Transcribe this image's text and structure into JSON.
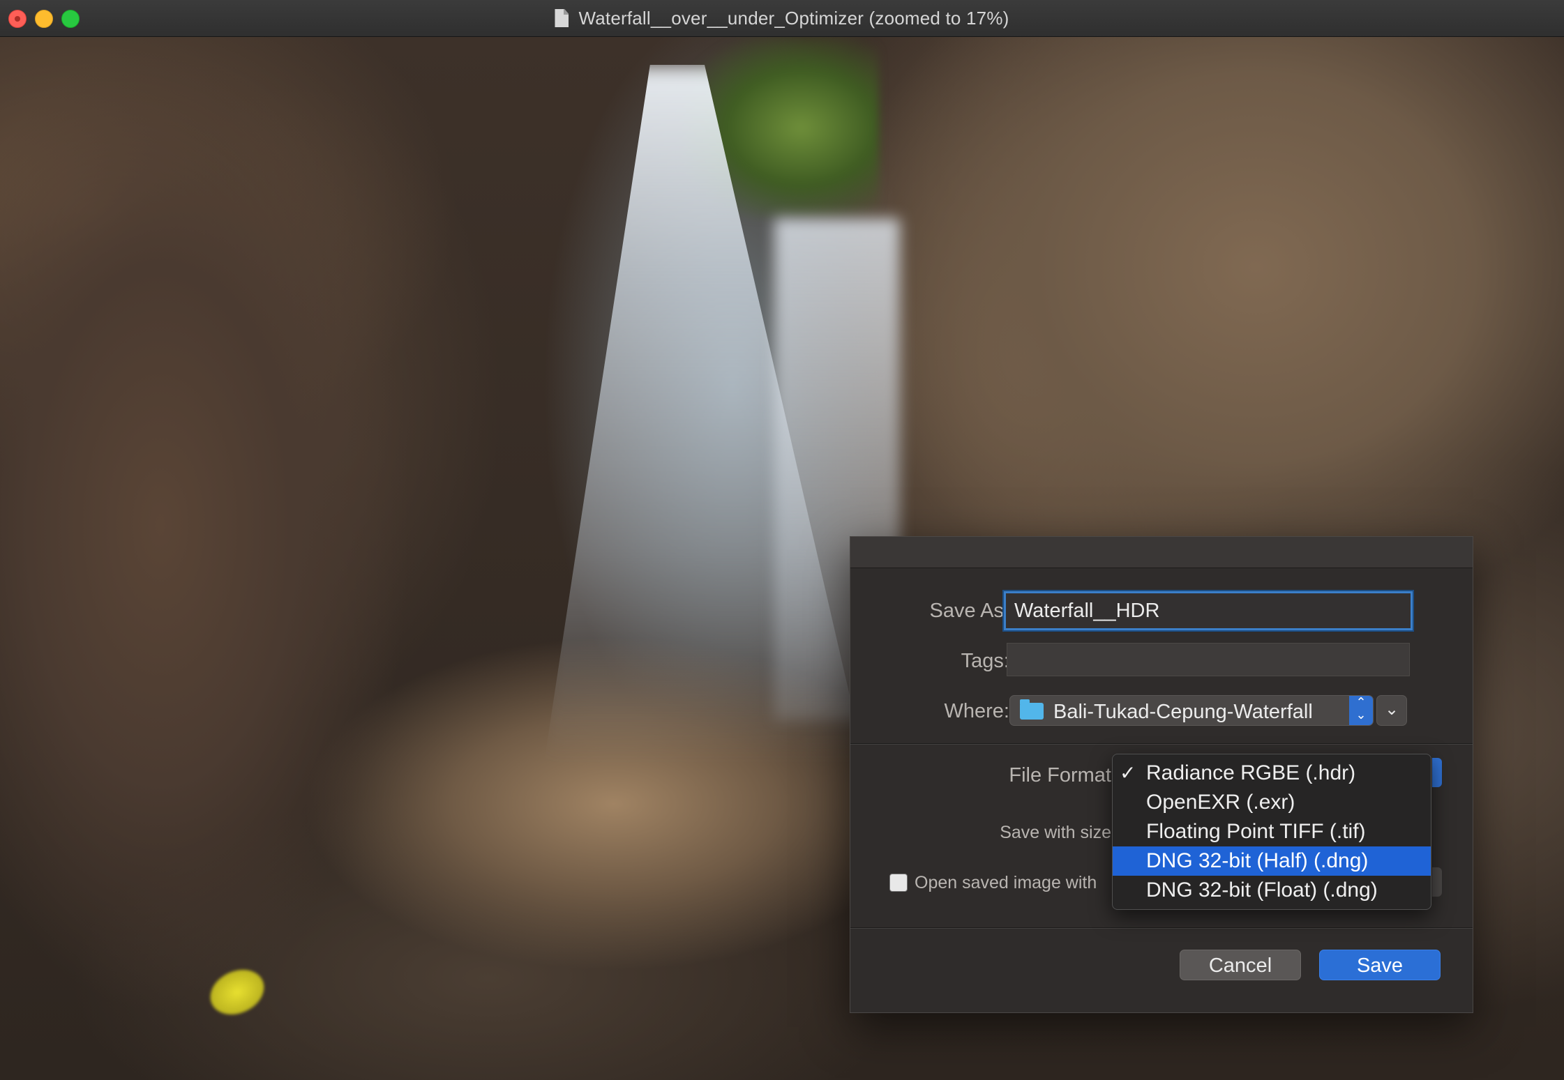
{
  "window": {
    "title": "Waterfall__over__under_Optimizer (zoomed to 17%)"
  },
  "dialog": {
    "save_as_label": "Save As:",
    "save_as_value": "Waterfall__HDR",
    "tags_label": "Tags:",
    "tags_value": "",
    "where_label": "Where:",
    "where_value": "Bali-Tukad-Cepung-Waterfall",
    "file_format_label": "File Format",
    "save_with_size_label": "Save with size",
    "open_saved_label": "Open saved image with",
    "open_saved_checked": false,
    "cancel_label": "Cancel",
    "save_label": "Save"
  },
  "format_menu": {
    "items": [
      {
        "label": "Radiance RGBE (.hdr)",
        "checked": true,
        "highlighted": false
      },
      {
        "label": "OpenEXR (.exr)",
        "checked": false,
        "highlighted": false
      },
      {
        "label": "Floating Point TIFF (.tif)",
        "checked": false,
        "highlighted": false
      },
      {
        "label": "DNG 32-bit (Half) (.dng)",
        "checked": false,
        "highlighted": true
      },
      {
        "label": "DNG 32-bit (Float) (.dng)",
        "checked": false,
        "highlighted": false
      }
    ],
    "check_glyph": "✓"
  },
  "icons": {
    "document": "document-icon",
    "folder": "folder-icon",
    "stepper": "up-down-stepper-icon",
    "expand": "chevron-down-icon"
  },
  "colors": {
    "accent": "#2b6fd6",
    "dialog_bg": "#2f2c2b",
    "highlight": "#1f63d6"
  }
}
